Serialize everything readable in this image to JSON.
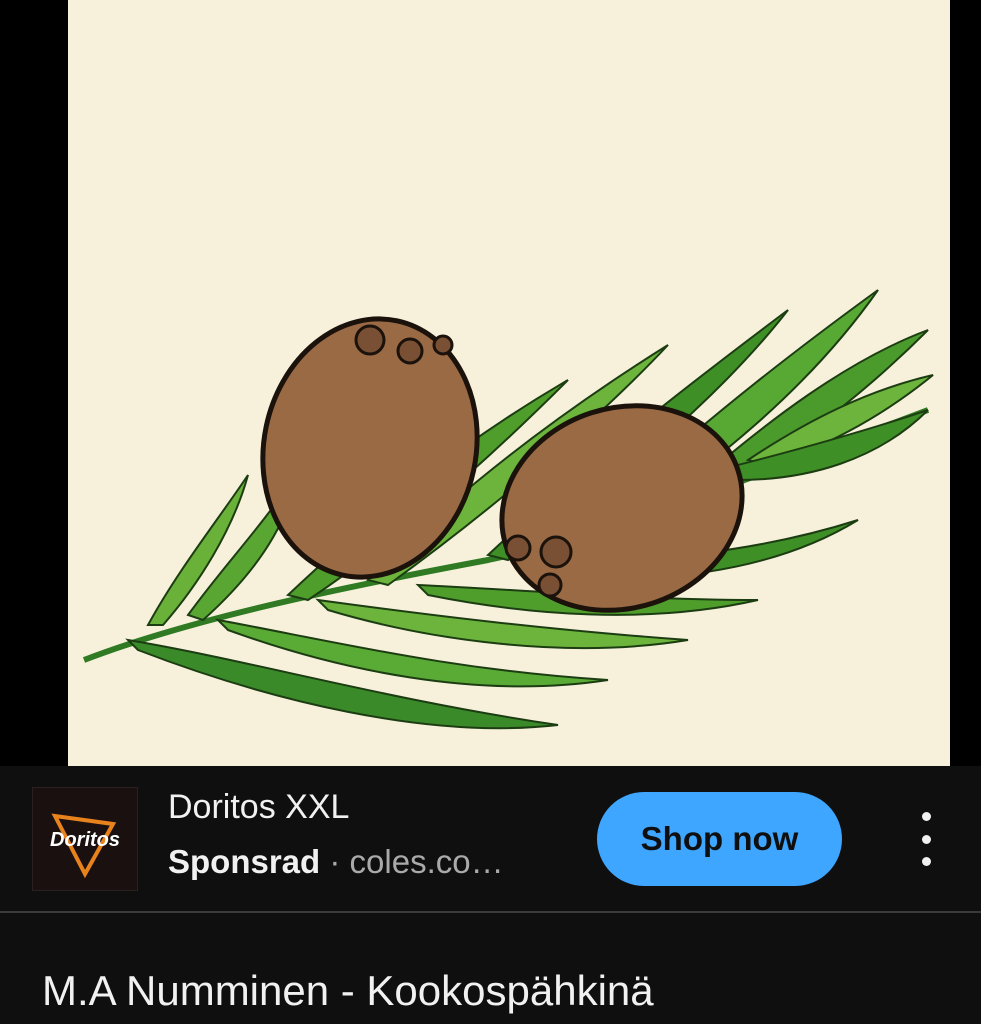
{
  "video": {
    "subject": "coconuts-on-palm-leaf-illustration"
  },
  "ad": {
    "logo_text": "Doritos",
    "title": "Doritos XXL",
    "sponsored_label": "Sponsrad",
    "separator": " · ",
    "domain": "coles.co…",
    "cta_label": "Shop now",
    "menu_icon": "more-vert-icon"
  },
  "video_info": {
    "title": "M.A Numminen - Kookospähkinä"
  },
  "colors": {
    "background": "#0f0f0f",
    "cta": "#3ea6ff",
    "frame": "#f7f1dc",
    "coconut": "#9a6a45",
    "leaf": "#57a832"
  }
}
